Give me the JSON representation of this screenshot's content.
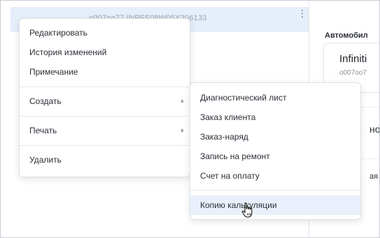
{
  "background": {
    "row_text": "o007oo77   INPFS08W05X206133",
    "right_panel": {
      "top_text": "",
      "heading": "Автомобил",
      "card_title": "Infiniti",
      "card_subtitle": "o007oo7",
      "fragment_1": "но",
      "fragment_2": "ая"
    }
  },
  "menu": {
    "items": [
      {
        "label": "Редактировать"
      },
      {
        "label": "История изменений"
      },
      {
        "label": "Примечание"
      },
      {
        "label": "Создать",
        "submenu": true
      },
      {
        "label": "Печать",
        "submenu": true
      },
      {
        "label": "Удалить"
      }
    ]
  },
  "submenu": {
    "items": [
      {
        "label": "Диагностический лист"
      },
      {
        "label": "Заказ клиента"
      },
      {
        "label": "Заказ-наряд"
      },
      {
        "label": "Запись на ремонт"
      },
      {
        "label": "Счет на оплату"
      },
      {
        "label": "Копию калькуляции",
        "hovered": true
      }
    ]
  },
  "colors": {
    "hover": "#e9f0fb",
    "row_highlight": "#e6eefa",
    "border": "#dde1e6"
  },
  "icons": {
    "kebab": "more-vertical-icon",
    "arrow": "chevron-right-icon",
    "cursor": "hand-pointer-icon"
  }
}
